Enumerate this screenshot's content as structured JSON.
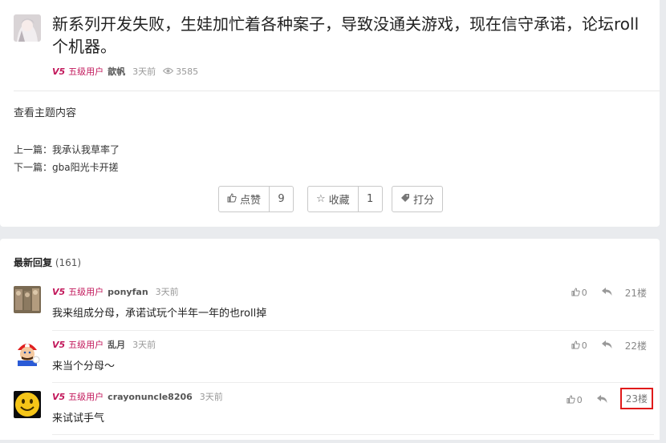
{
  "topic": {
    "title": "新系列开发失败，生娃加忙着各种案子，导致没通关游戏，现在信守承诺，论坛roll个机器。",
    "level_icon": "V5",
    "level_label": "五级用户",
    "author": "歆帆",
    "time": "3天前",
    "view_icon": "eye-icon",
    "views": "3585",
    "view_topic_label": "查看主题内容",
    "prev_label": "上一篇：",
    "prev_title": "我承认我草率了",
    "next_label": "下一篇：",
    "next_title": "gba阳光卡开搓",
    "like_label": "点赞",
    "like_count": "9",
    "favorite_label": "收藏",
    "favorite_count": "1",
    "rate_label": "打分"
  },
  "replies_section": {
    "header": "最新回复",
    "count": "(161)"
  },
  "replies": [
    {
      "level_icon": "V5",
      "level_label": "五级用户",
      "author": "ponyfan",
      "time": "3天前",
      "content": "我来组成分母，承诺试玩个半年一年的也roll掉",
      "likes": "0",
      "floor": "21楼"
    },
    {
      "level_icon": "V5",
      "level_label": "五级用户",
      "author": "乱月",
      "time": "3天前",
      "content": "来当个分母～",
      "likes": "0",
      "floor": "22楼"
    },
    {
      "level_icon": "V5",
      "level_label": "五级用户",
      "author": "crayonuncle8206",
      "time": "3天前",
      "content": "来试试手气",
      "likes": "0",
      "floor": "23楼"
    }
  ],
  "colors": {
    "level_accent": "#c2185b",
    "highlight_border": "#e01a1a",
    "page_background": "#e9ebee"
  }
}
